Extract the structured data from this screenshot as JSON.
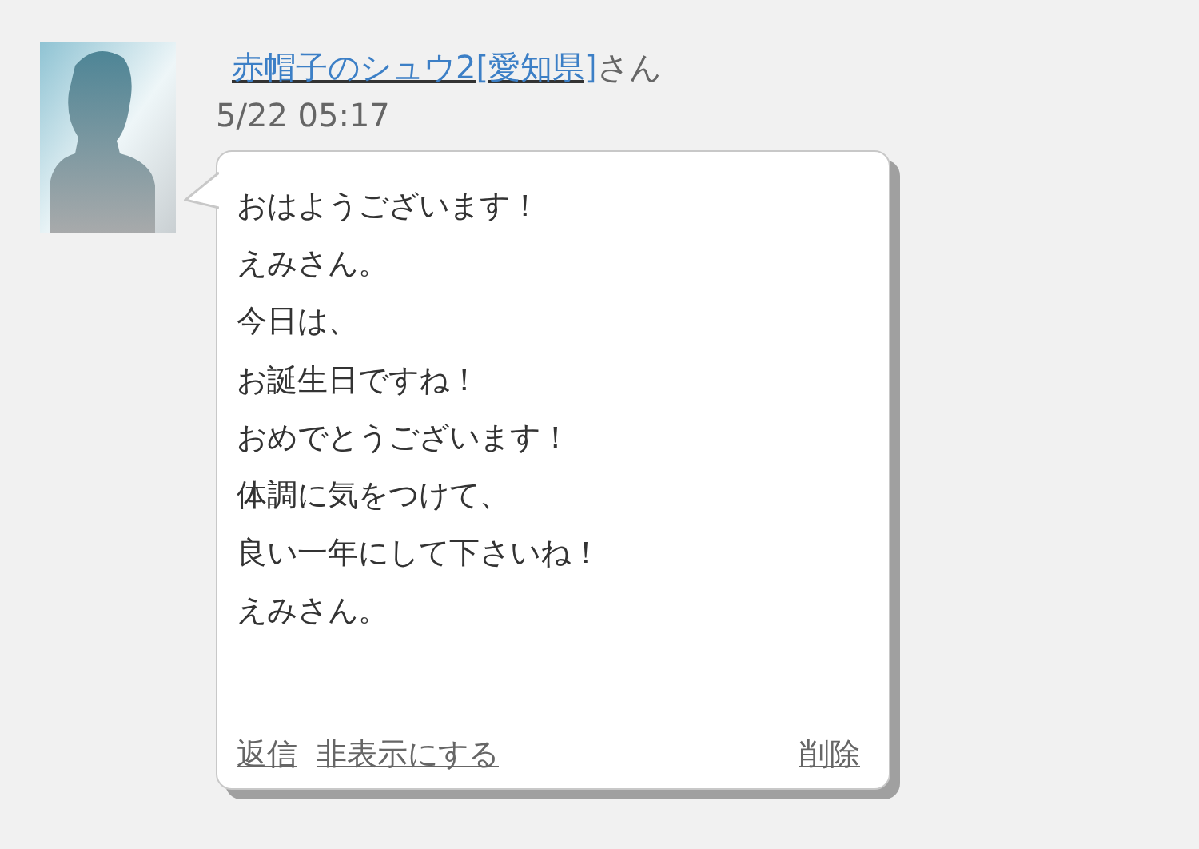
{
  "post": {
    "author": "赤帽子のシュウ2[愛知県]",
    "honorific": "さん",
    "time": "5/22 05:17",
    "message_lines": [
      "おはようございます！",
      "えみさん。",
      "今日は、",
      "お誕生日ですね！",
      "おめでとうございます！",
      "体調に気をつけて、",
      "良い一年にして下さいね！",
      "えみさん。"
    ],
    "actions": [
      {
        "label": "返信",
        "kind": "left"
      },
      {
        "label": "非表示にする",
        "kind": "left"
      },
      {
        "label": "削除",
        "kind": "right"
      }
    ]
  }
}
